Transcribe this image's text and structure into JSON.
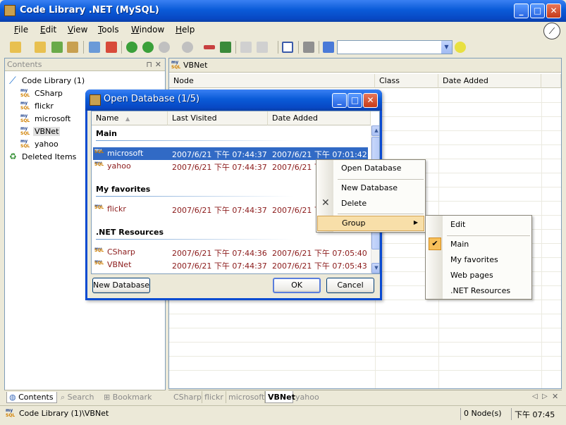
{
  "window": {
    "title": "Code Library .NET (MySQL)"
  },
  "menu": [
    "File",
    "Edit",
    "View",
    "Tools",
    "Window",
    "Help"
  ],
  "left_pane": {
    "header": "Contents",
    "tree": {
      "root": "Code Library (1)",
      "children": [
        "CSharp",
        "flickr",
        "microsoft",
        "VBNet",
        "yahoo"
      ],
      "selected": "VBNet",
      "deleted": "Deleted Items"
    },
    "tabs": [
      "Contents",
      "Search",
      "Bookmark"
    ]
  },
  "right_pane": {
    "header": "VBNet",
    "columns": [
      "Node",
      "Class",
      "Date Added"
    ],
    "tabs": [
      "CSharp",
      "flickr",
      "microsoft",
      "VBNet",
      "yahoo"
    ],
    "active_tab": "VBNet"
  },
  "status": {
    "path": "Code Library (1)\\VBNet",
    "nodes": "0 Node(s)",
    "time": "下午 07:45"
  },
  "dialog": {
    "title": "Open Database (1/5)",
    "columns": [
      "Name",
      "Last Visited",
      "Date Added"
    ],
    "groups": [
      {
        "name": "Main",
        "rows": [
          {
            "name": "microsoft",
            "visited": "2007/6/21 下午 07:44:37",
            "added": "2007/6/21 下午 07:01:42",
            "selected": true
          },
          {
            "name": "yahoo",
            "visited": "2007/6/21 下午 07:44:37",
            "added": "2007/6/21 下午 07:"
          }
        ]
      },
      {
        "name": "My favorites",
        "rows": [
          {
            "name": "flickr",
            "visited": "2007/6/21 下午 07:44:37",
            "added": "2007/6/21 下午 07:"
          }
        ]
      },
      {
        "name": ".NET Resources",
        "rows": [
          {
            "name": "CSharp",
            "visited": "2007/6/21 下午 07:44:36",
            "added": "2007/6/21 下午 07:05:40"
          },
          {
            "name": "VBNet",
            "visited": "2007/6/21 下午 07:44:37",
            "added": "2007/6/21 下午 07:05:43"
          }
        ]
      }
    ],
    "buttons": {
      "new": "New Database",
      "ok": "OK",
      "cancel": "Cancel"
    }
  },
  "context_menu": {
    "items": [
      "Open Database",
      "New Database",
      "Delete",
      "Group"
    ],
    "highlighted": "Group"
  },
  "group_submenu": {
    "items": [
      "Edit",
      "Main",
      "My favorites",
      "Web pages",
      ".NET Resources"
    ],
    "checked": "Main"
  },
  "colors": {
    "titlebar": "#0a5bd8",
    "selection": "#316ac5",
    "menu_highlight": "#f8dfa9",
    "row_text": "#8b1a1a"
  }
}
